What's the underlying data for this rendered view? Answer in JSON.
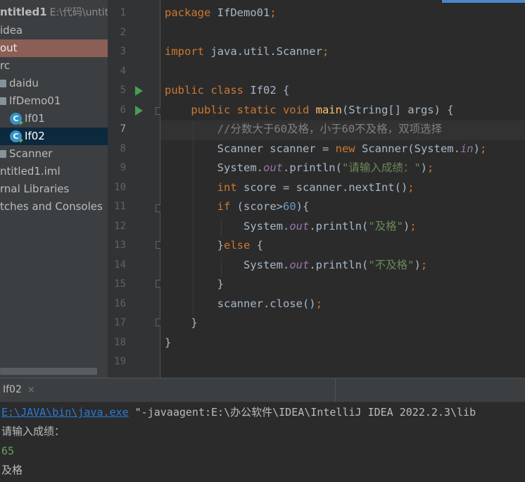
{
  "project_tree": {
    "root_label": "ntitled1",
    "root_path": "E:\\代码\\untitled",
    "items": [
      {
        "label": "idea"
      },
      {
        "label": "out"
      },
      {
        "label": "rc"
      },
      {
        "label": "daidu"
      },
      {
        "label": "IfDemo01"
      },
      {
        "label": "If01"
      },
      {
        "label": "If02"
      },
      {
        "label": "Scanner"
      },
      {
        "label": "ntitled1.iml"
      },
      {
        "label": "rnal Libraries"
      },
      {
        "label": "tches and Consoles"
      }
    ]
  },
  "editor": {
    "line_numbers": [
      "1",
      "2",
      "3",
      "4",
      "5",
      "6",
      "7",
      "8",
      "9",
      "10",
      "11",
      "12",
      "13",
      "14",
      "15",
      "16",
      "17",
      "18",
      "19"
    ],
    "current_line": "7"
  },
  "run_panel": {
    "tab_label": "If02",
    "tab_close": "×",
    "console": {
      "java_path": "E:\\JAVA\\bin\\java.exe",
      "args": " \"-javaagent:E:\\办公软件\\IDEA\\IntelliJ IDEA 2022.2.3\\lib",
      "prompt": "请输入成绩：",
      "input": "65",
      "result": "及格"
    }
  },
  "colors": {
    "keyword": "#cc7832",
    "method": "#ffc66d",
    "static_field": "#9876aa",
    "string": "#6a8759",
    "number": "#6897bb",
    "comment": "#808080",
    "run_icon": "#499c54",
    "link": "#287bde"
  }
}
